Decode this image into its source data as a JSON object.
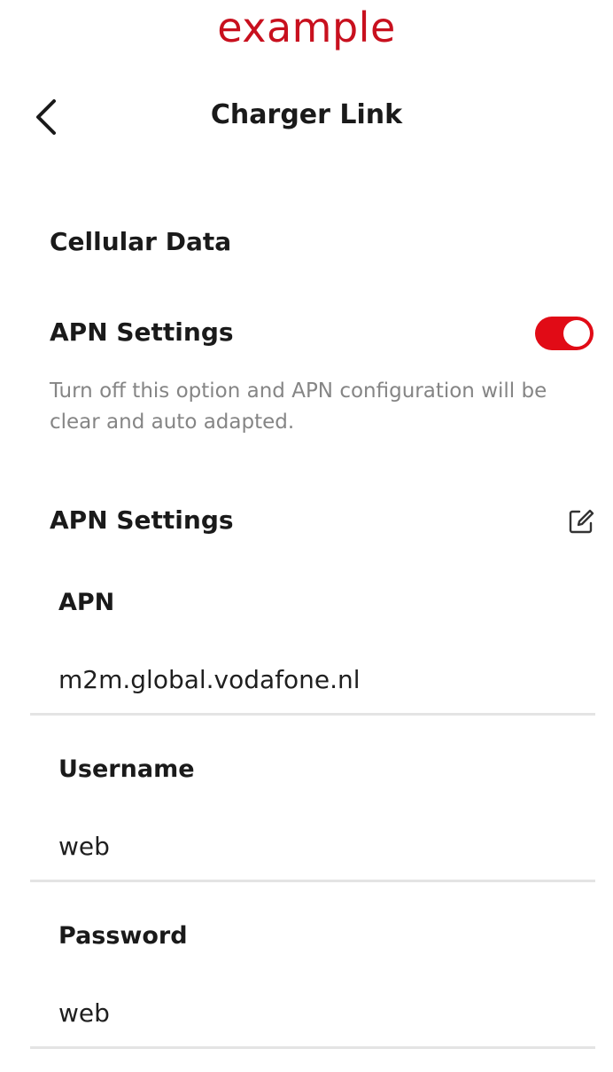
{
  "watermark": "example",
  "header": {
    "title": "Charger Link",
    "back_icon": "chevron-left-icon"
  },
  "cellular": {
    "section_title": "Cellular Data",
    "apn_toggle_label": "APN Settings",
    "apn_toggle_on": true,
    "toggle_color": "#e10b16",
    "hint": "Turn off this option and APN configuration will be clear and auto adapted."
  },
  "apn": {
    "section_title": "APN Settings",
    "edit_icon": "edit-icon",
    "fields": [
      {
        "label": "APN",
        "value": "m2m.global.vodafone.nl"
      },
      {
        "label": "Username",
        "value": "web"
      },
      {
        "label": "Password",
        "value": "web"
      }
    ]
  }
}
